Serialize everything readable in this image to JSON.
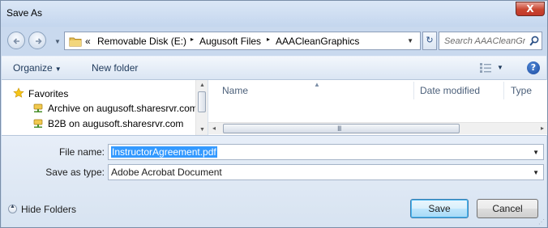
{
  "window": {
    "title": "Save As"
  },
  "titlebar": {
    "close_symbol": "X"
  },
  "nav": {
    "breadcrumb": {
      "overflow": "«",
      "items": [
        "Removable Disk (E:)",
        "Augusoft Files",
        "AAACleanGraphics"
      ],
      "separator": "▸"
    },
    "search_placeholder": "Search AAACleanGraphi..."
  },
  "toolbar": {
    "organize_label": "Organize",
    "new_folder_label": "New folder",
    "help_symbol": "?"
  },
  "navigation_pane": {
    "items": [
      {
        "label": "Favorites",
        "icon": "star-icon"
      },
      {
        "label": "Archive on augusoft.sharesrvr.com",
        "icon": "network-drive-icon"
      },
      {
        "label": "B2B on augusoft.sharesrvr.com",
        "icon": "network-drive-icon"
      }
    ]
  },
  "file_list": {
    "columns": [
      "Name",
      "Date modified",
      "Type"
    ],
    "scroll_grip": "III"
  },
  "form": {
    "file_name_label": "File name:",
    "file_name_value": "InstructorAgreement.pdf",
    "save_type_label": "Save as type:",
    "save_type_value": "Adobe Acrobat Document"
  },
  "footer": {
    "hide_folders_label": "Hide Folders",
    "save_label": "Save",
    "cancel_label": "Cancel"
  },
  "colors": {
    "selection": "#3399ff",
    "accent": "#1e395b"
  }
}
